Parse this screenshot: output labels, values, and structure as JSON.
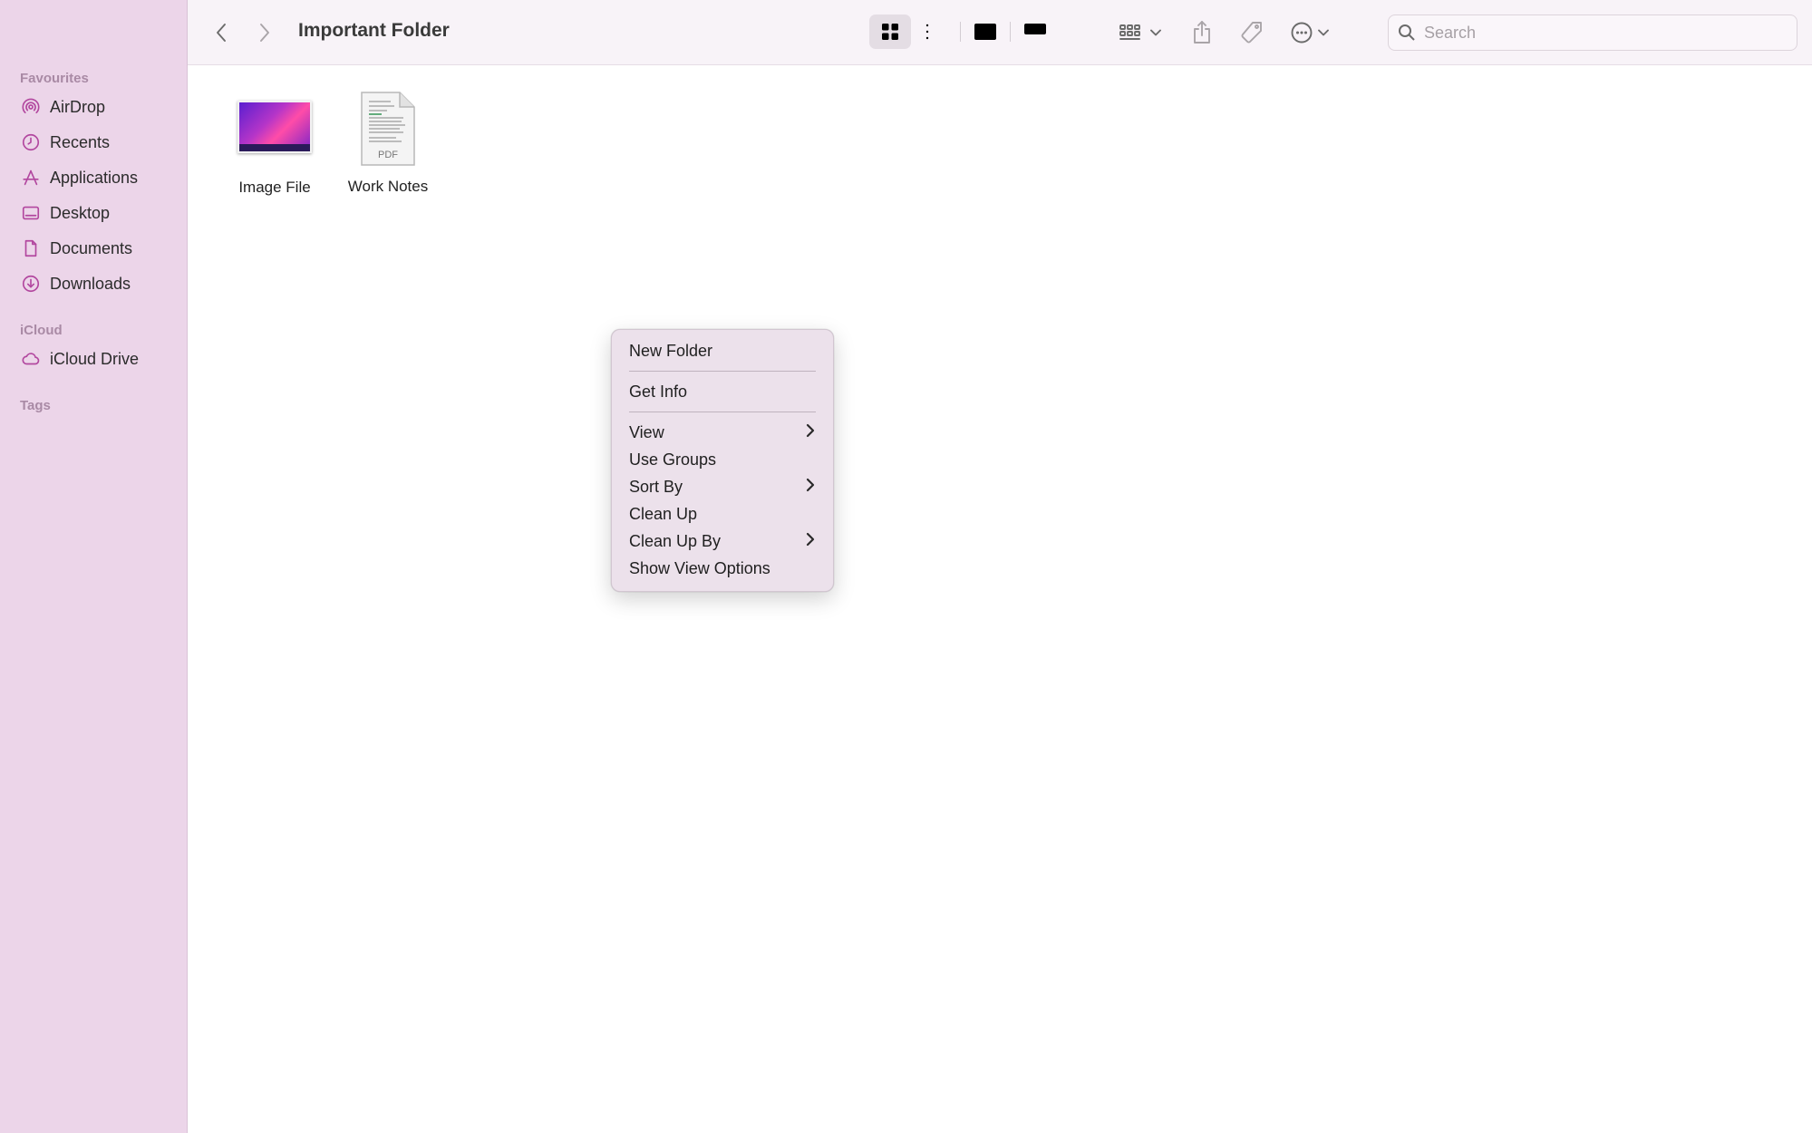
{
  "window": {
    "title": "Important Folder"
  },
  "sidebar": {
    "favourites_header": "Favourites",
    "favourites": [
      {
        "label": "AirDrop",
        "icon": "airdrop-icon"
      },
      {
        "label": "Recents",
        "icon": "clock-icon"
      },
      {
        "label": "Applications",
        "icon": "applications-icon"
      },
      {
        "label": "Desktop",
        "icon": "desktop-icon"
      },
      {
        "label": "Documents",
        "icon": "document-icon"
      },
      {
        "label": "Downloads",
        "icon": "download-icon"
      }
    ],
    "icloud_header": "iCloud",
    "icloud": [
      {
        "label": "iCloud Drive",
        "icon": "cloud-icon"
      }
    ],
    "tags_header": "Tags"
  },
  "toolbar": {
    "search_placeholder": "Search",
    "active_view": "icon"
  },
  "files": [
    {
      "name": "Image File",
      "type": "image"
    },
    {
      "name": "Work Notes",
      "type": "pdf",
      "badge": "PDF"
    }
  ],
  "context_menu": {
    "groups": [
      [
        {
          "label": "New Folder",
          "submenu": false
        }
      ],
      [
        {
          "label": "Get Info",
          "submenu": false
        }
      ],
      [
        {
          "label": "View",
          "submenu": true
        },
        {
          "label": "Use Groups",
          "submenu": false
        },
        {
          "label": "Sort By",
          "submenu": true
        },
        {
          "label": "Clean Up",
          "submenu": false
        },
        {
          "label": "Clean Up By",
          "submenu": true
        },
        {
          "label": "Show View Options",
          "submenu": false
        }
      ]
    ]
  },
  "colors": {
    "sidebar_bg": "#ecd5e9",
    "accent": "#b2479f",
    "toolbar_bg": "#f8f3f8",
    "menu_bg": "#ece1eb"
  }
}
